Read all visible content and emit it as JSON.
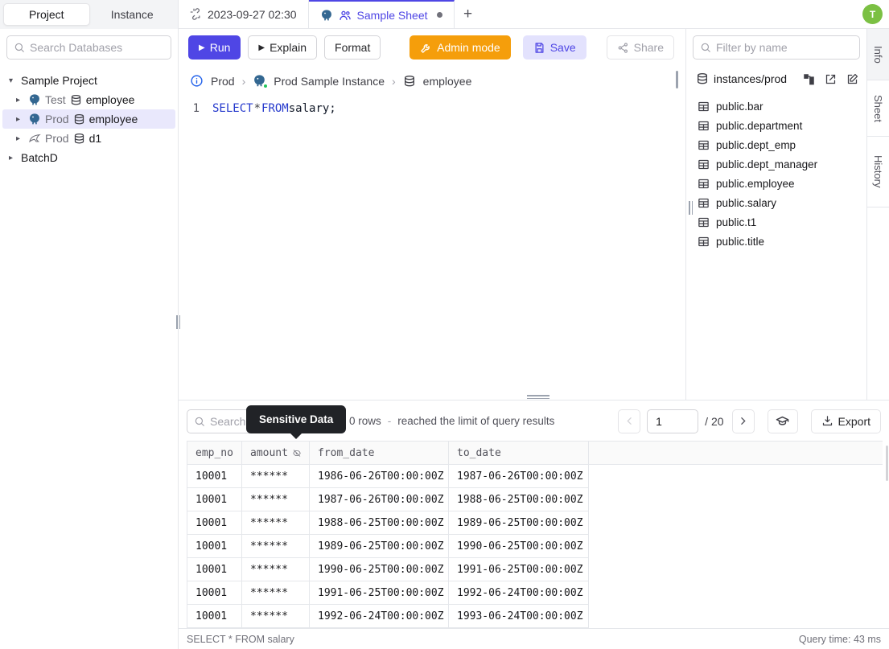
{
  "colors": {
    "accent_indigo": "#4f46e5",
    "admin_orange": "#f59e0b",
    "save_bg": "#e3e2fd",
    "avatar_green": "#7bc043",
    "tooltip_bg": "#212327",
    "selected_row_bg": "#e9e8fc",
    "sql_keyword_blue": "#2438cc",
    "postgres_blue": "#336791",
    "status_green": "#22c55e"
  },
  "icons": {
    "caret_down": "▾",
    "caret_right": "▸",
    "play": "▶",
    "chevron": "›",
    "plus": "+"
  },
  "left_sidebar": {
    "tabs": {
      "project": "Project",
      "instance": "Instance"
    },
    "search_placeholder": "Search Databases",
    "tree": {
      "root_label": "Sample Project",
      "items": [
        {
          "engine": "postgres",
          "env": "Test",
          "db": "employee"
        },
        {
          "engine": "postgres",
          "env": "Prod",
          "db": "employee"
        },
        {
          "engine": "mysql",
          "env": "Prod",
          "db": "d1"
        }
      ],
      "batch_label": "BatchD"
    }
  },
  "tab_bar": {
    "tabs": [
      {
        "label": "2023-09-27 02:30"
      },
      {
        "label": "Sample Sheet"
      }
    ],
    "new_tab": "+",
    "avatar_initial": "T"
  },
  "toolbar": {
    "run": "Run",
    "explain": "Explain",
    "format": "Format",
    "admin_mode": "Admin mode",
    "save": "Save",
    "share": "Share"
  },
  "breadcrumb": {
    "environment": "Prod",
    "instance": "Prod Sample Instance",
    "database": "employee"
  },
  "editor": {
    "line_number": "1",
    "kw1": "SELECT",
    "star": "*",
    "kw2": "FROM",
    "tail": "salary;"
  },
  "right_panel": {
    "filter_placeholder": "Filter by name",
    "connection": "instances/prod",
    "tables": [
      "public.bar",
      "public.department",
      "public.dept_emp",
      "public.dept_manager",
      "public.employee",
      "public.salary",
      "public.t1",
      "public.title"
    ]
  },
  "side_tabs": [
    "Info",
    "Sheet",
    "History"
  ],
  "results": {
    "search_placeholder": "Search",
    "tooltip": "Sensitive Data",
    "rows_count": "0 rows",
    "rows_sep": "-",
    "limit_text": "reached the limit of query results",
    "page": "1",
    "page_total": "/ 20",
    "export": "Export",
    "columns": [
      "emp_no",
      "amount",
      "from_date",
      "to_date"
    ],
    "masked_column": "amount",
    "rows": [
      [
        "10001",
        "******",
        "1986-06-26T00:00:00Z",
        "1987-06-26T00:00:00Z"
      ],
      [
        "10001",
        "******",
        "1987-06-26T00:00:00Z",
        "1988-06-25T00:00:00Z"
      ],
      [
        "10001",
        "******",
        "1988-06-25T00:00:00Z",
        "1989-06-25T00:00:00Z"
      ],
      [
        "10001",
        "******",
        "1989-06-25T00:00:00Z",
        "1990-06-25T00:00:00Z"
      ],
      [
        "10001",
        "******",
        "1990-06-25T00:00:00Z",
        "1991-06-25T00:00:00Z"
      ],
      [
        "10001",
        "******",
        "1991-06-25T00:00:00Z",
        "1992-06-24T00:00:00Z"
      ],
      [
        "10001",
        "******",
        "1992-06-24T00:00:00Z",
        "1993-06-24T00:00:00Z"
      ]
    ],
    "status_query": "SELECT * FROM salary",
    "status_time": "Query time: 43 ms"
  }
}
